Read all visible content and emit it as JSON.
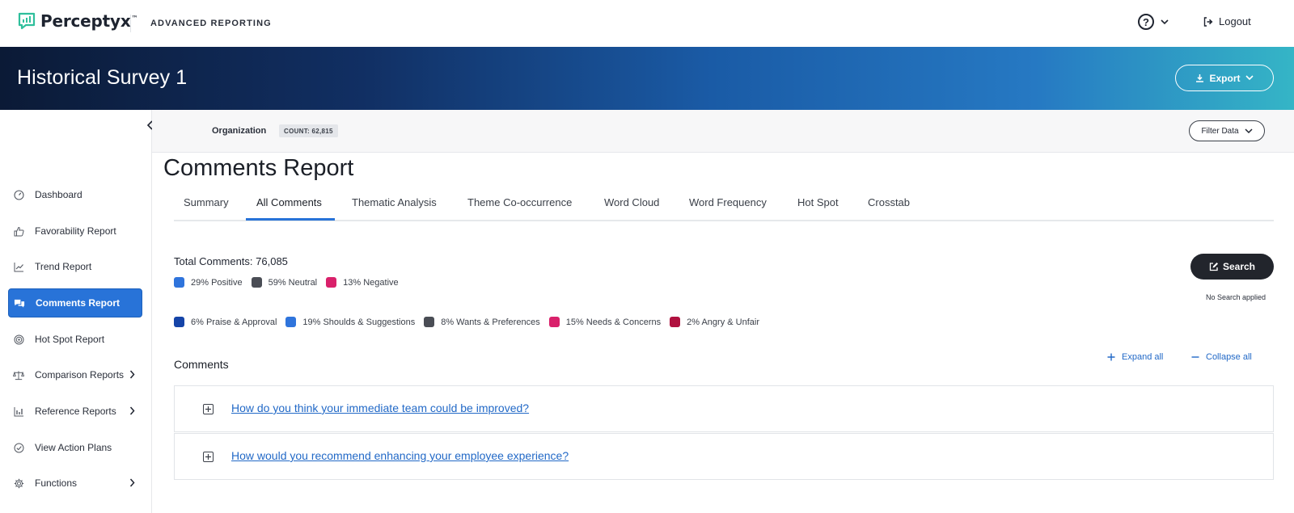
{
  "header": {
    "brand": "Perceptyx",
    "brand_tm": "™",
    "app_name": "ADVANCED REPORTING",
    "logout_label": "Logout"
  },
  "banner": {
    "title": "Historical Survey 1",
    "export_label": "Export"
  },
  "filter_bar": {
    "org_label": "Organization",
    "count_badge": "COUNT: 62,815",
    "filter_label": "Filter Data"
  },
  "sidebar": {
    "items": [
      {
        "label": "Dashboard",
        "icon": "dashboard-gauge-icon",
        "has_submenu": false,
        "active": false
      },
      {
        "label": "Favorability Report",
        "icon": "thumbs-up-icon",
        "has_submenu": false,
        "active": false
      },
      {
        "label": "Trend Report",
        "icon": "trend-line-icon",
        "has_submenu": false,
        "active": false
      },
      {
        "label": "Comments Report",
        "icon": "comments-icon",
        "has_submenu": false,
        "active": true
      },
      {
        "label": "Hot Spot Report",
        "icon": "target-icon",
        "has_submenu": false,
        "active": false
      },
      {
        "label": "Comparison Reports",
        "icon": "scale-icon",
        "has_submenu": true,
        "active": false
      },
      {
        "label": "Reference Reports",
        "icon": "bar-chart-icon",
        "has_submenu": true,
        "active": false
      },
      {
        "label": "View Action Plans",
        "icon": "check-circle-icon",
        "has_submenu": false,
        "active": false
      },
      {
        "label": "Functions",
        "icon": "gear-icon",
        "has_submenu": true,
        "active": false
      }
    ]
  },
  "main": {
    "title": "Comments Report",
    "tabs": [
      {
        "label": "Summary",
        "active": false
      },
      {
        "label": "All Comments",
        "active": true
      },
      {
        "label": "Thematic Analysis",
        "active": false
      },
      {
        "label": "Theme Co-occurrence",
        "active": false
      },
      {
        "label": "Word Cloud",
        "active": false
      },
      {
        "label": "Word Frequency",
        "active": false
      },
      {
        "label": "Hot Spot",
        "active": false
      },
      {
        "label": "Crosstab",
        "active": false
      }
    ],
    "total_comments": "Total Comments: 76,085",
    "sentiment": [
      {
        "label": "29% Positive",
        "color": "#2f74dc"
      },
      {
        "label": "59% Neutral",
        "color": "#4a4d55"
      },
      {
        "label": "13% Negative",
        "color": "#d9216b"
      }
    ],
    "categories": [
      {
        "label": "6% Praise & Approval",
        "color": "#1544a8"
      },
      {
        "label": "19% Shoulds & Suggestions",
        "color": "#2f74dc"
      },
      {
        "label": "8% Wants & Preferences",
        "color": "#4a4d55"
      },
      {
        "label": "15% Needs & Concerns",
        "color": "#d9216b"
      },
      {
        "label": "2% Angry & Unfair",
        "color": "#b0113f"
      }
    ],
    "search_label": "Search",
    "search_status": "No Search applied",
    "comments_label": "Comments",
    "expand_all": "Expand all",
    "collapse_all": "Collapse all",
    "questions": [
      {
        "text": "How do you think your immediate team could be improved?"
      },
      {
        "text": "How would you recommend enhancing your employee experience?"
      }
    ]
  },
  "colors": {
    "accent": "#2873d8",
    "link": "#2269c7",
    "brand_green": "#2fbf9c"
  }
}
